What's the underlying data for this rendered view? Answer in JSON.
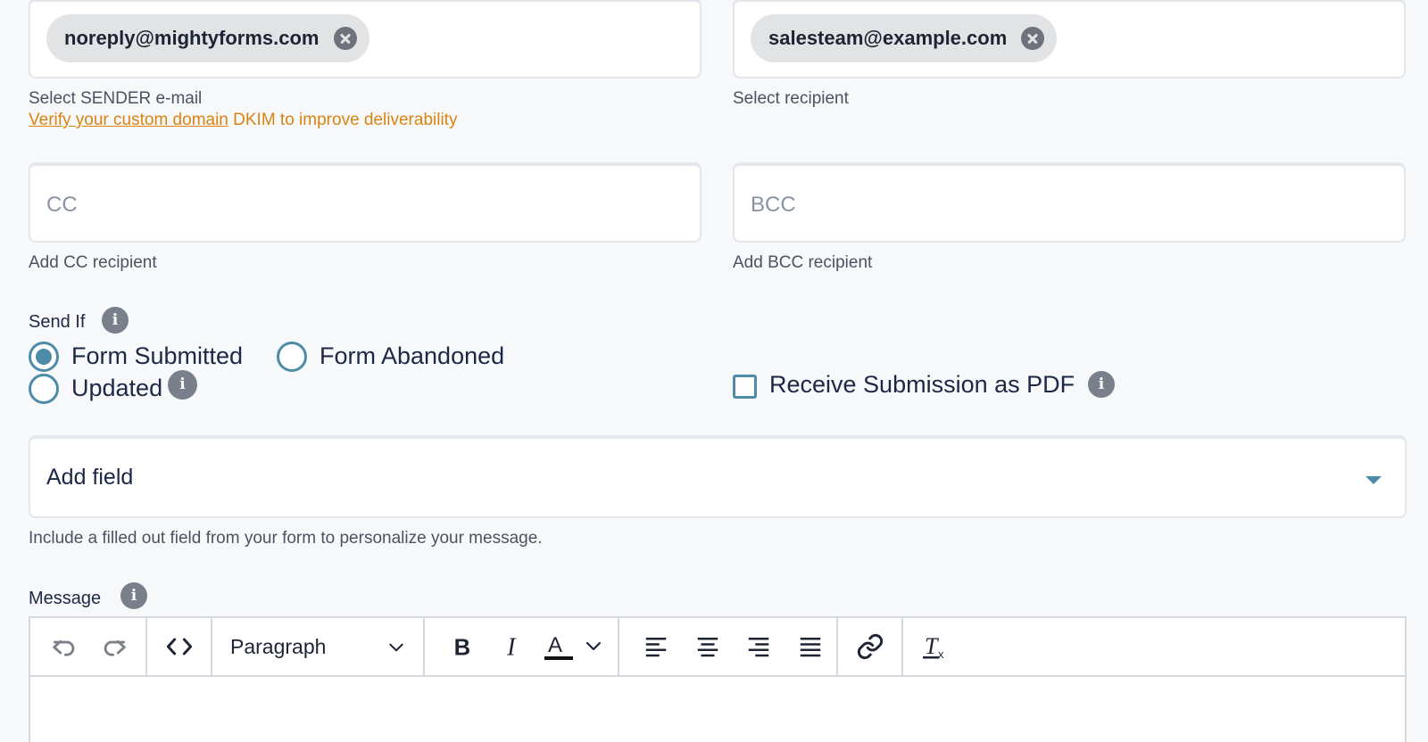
{
  "sender": {
    "chip": "noreply@mightyforms.com",
    "help": "Select SENDER e-mail",
    "verify_link": "Verify your custom domain",
    "verify_rest": " DKIM to improve deliverability"
  },
  "recipient": {
    "chip": "salesteam@example.com",
    "help": "Select recipient"
  },
  "cc": {
    "placeholder": "CC",
    "help": "Add CC recipient"
  },
  "bcc": {
    "placeholder": "BCC",
    "help": "Add BCC recipient"
  },
  "send_if": {
    "label": "Send If",
    "options": [
      {
        "label": "Form Submitted",
        "checked": true
      },
      {
        "label": "Form Abandoned",
        "checked": false
      },
      {
        "label": "Updated",
        "checked": false
      }
    ]
  },
  "pdf": {
    "label": "Receive Submission as PDF",
    "checked": false
  },
  "add_field": {
    "label": "Add field",
    "help": "Include a filled out field from your form to personalize your message."
  },
  "message": {
    "label": "Message",
    "format": "Paragraph",
    "toolbar_icons": [
      "undo-icon",
      "redo-icon",
      "source-code-icon",
      "bold-icon",
      "italic-icon",
      "text-color-icon",
      "align-left-icon",
      "align-center-icon",
      "align-right-icon",
      "align-justify-icon",
      "link-icon",
      "clear-format-icon"
    ]
  },
  "colors": {
    "accent": "#4e8ba8",
    "warning": "#d98311",
    "text": "#1d2746",
    "background": "#f7f8fa"
  }
}
